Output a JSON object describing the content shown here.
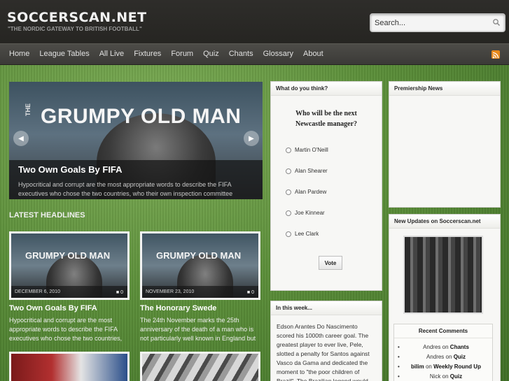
{
  "header": {
    "site_title": "SOCCERSCAN.NET",
    "tagline": "\"THE NORDIC GATEWAY TO BRITISH FOOTBALL\"",
    "search_placeholder": "Search..."
  },
  "nav": {
    "items": [
      "Home",
      "League Tables",
      "All Live",
      "Fixtures",
      "Forum",
      "Quiz",
      "Chants",
      "Glossary",
      "About"
    ],
    "rss_icon": "rss-icon"
  },
  "slider": {
    "brand_small": "THE",
    "brand": "GRUMPY OLD MAN",
    "headline": "Two Own Goals By FIFA",
    "excerpt": "Hypocritical and corrupt are the most appropriate words to describe the FIFA executives who chose the two countries, who their own inspection committee"
  },
  "latest": {
    "heading": "LATEST HEADLINES",
    "posts": [
      {
        "brand": "GRUMPY OLD MAN",
        "date": "DECEMBER 6, 2010",
        "comments": "0",
        "title": "Two Own Goals By FIFA",
        "excerpt": "Hypocritical and corrupt are the most appropriate words to describe the FIFA executives who chose the two countries,"
      },
      {
        "brand": "GRUMPY OLD MAN",
        "date": "NOVEMBER 23, 2010",
        "comments": "0",
        "title": "The Honorary Swede",
        "excerpt": "The 24th November marks the 25th anniversary of the death of a man who is not particularly well known in England but"
      }
    ]
  },
  "poll": {
    "title": "What do you think?",
    "question": "Who will be the next Newcastle manager?",
    "options": [
      "Martin O'Neill",
      "Alan Shearer",
      "Alan Pardew",
      "Joe Kinnear",
      "Lee Clark"
    ],
    "vote_label": "Vote"
  },
  "this_week": {
    "title": "In this week...",
    "text": "Edson Arantes Do Nascimento scored his 1000th career goal. The greatest player to ever live, Pele, slotted a penalty for Santos against Vasco da Gama and dedicated the moment to \"the poor children of Brazil\". The Brazilian legend would"
  },
  "premiership_news": {
    "title": "Premiership News"
  },
  "new_updates": {
    "title": "New Updates on Soccerscan.net",
    "recent_comments_title": "Recent Comments",
    "comments": [
      {
        "author": "Andres",
        "on": "on",
        "post": "Chants"
      },
      {
        "author": "Andres",
        "on": "on",
        "post": "Quiz"
      },
      {
        "author": "bilim",
        "on": "on",
        "post": "Weekly Round Up"
      },
      {
        "author": "Nick",
        "on": "on",
        "post": "Quiz"
      }
    ]
  },
  "colors": {
    "header_bg": "#2b2a27",
    "nav_bg": "#45443f",
    "grass": "#5c8f3a",
    "rss": "#e8891c"
  }
}
